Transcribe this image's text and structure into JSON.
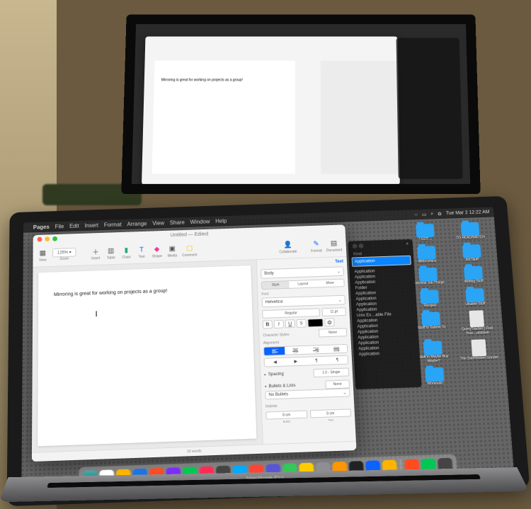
{
  "menubar": {
    "app": "Pages",
    "items": [
      "File",
      "Edit",
      "Insert",
      "Format",
      "Arrange",
      "View",
      "Share",
      "Window",
      "Help"
    ],
    "clock": "Tue Mar 2  12:22 AM"
  },
  "window": {
    "title": "Untitled — Edited",
    "zoom_label": "Zoom",
    "zoom_value": "125% ▾",
    "tools": {
      "view": "View",
      "insert": "Insert",
      "table": "Table",
      "chart": "Chart",
      "text": "Text",
      "shape": "Shape",
      "media": "Media",
      "comment": "Comment",
      "collaborate": "Collaborate",
      "format": "Format",
      "document": "Document"
    },
    "status": "10 words"
  },
  "document": {
    "body_text": "Mirroring is great for working on projects as a group!"
  },
  "inspector": {
    "tabs": {
      "text": "Text",
      "format": "Format",
      "document": "Document"
    },
    "paragraph_style": "Body",
    "seg": {
      "style": "Style",
      "layout": "Layout",
      "more": "More"
    },
    "font_label": "Font",
    "font_family": "Helvetica",
    "font_style": "Regular",
    "font_size": "11 pt",
    "char_styles_label": "Character Styles",
    "char_styles_value": "None",
    "alignment_label": "Alignment",
    "spacing_label": "Spacing",
    "spacing_value": "1.0 - Single",
    "bullets_label": "Bullets & Lists",
    "bullets_value": "None",
    "no_bullets": "No Bullets",
    "indents_label": "Indents",
    "indent_bullet": "Bullet",
    "indent_bullet_v": "0 cm",
    "indent_text": "Text",
    "indent_text_v": "0 cm"
  },
  "finder_kind": {
    "header": "Kind",
    "rows": [
      "Application",
      "Application",
      "Application",
      "Application",
      "Folder",
      "Application",
      "Application",
      "Application",
      "Application",
      "Unix Ex…able File",
      "Application",
      "Application",
      "Application",
      "Application",
      "Application",
      "Application",
      "Application"
    ],
    "selected_index": 0
  },
  "desktop_folders": [
    "I GOT…",
    "TO READ/WATCH",
    "Webcomics",
    "Art Stuff",
    "Potential Job Things",
    "Writing Stuff",
    "Recipes",
    "Ukulele Stuff",
    "Stuff to Submit To",
    "QueryTracker | Find Your…atabase",
    "Stuff to Maybe Buy Maybe?",
    "The Submission Grinder",
    "Workouts!"
  ],
  "desktop_file_indices": [
    9,
    11
  ],
  "laptop_model": "MacBook Pro",
  "dock_apps": 22
}
